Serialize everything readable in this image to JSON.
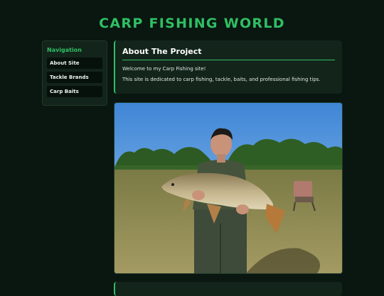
{
  "header": {
    "title": "CARP FISHING WORLD"
  },
  "sidebar": {
    "heading": "Navigation",
    "items": [
      {
        "label": "About Site"
      },
      {
        "label": "Tackle Brands"
      },
      {
        "label": "Carp Baits"
      }
    ]
  },
  "about": {
    "title": "About The Project",
    "paragraphs": [
      "Welcome to my Carp Fishing site!",
      "This site is dedicated to carp fishing, tackle, baits, and professional fishing tips."
    ]
  },
  "photo": {
    "subject": "person-holding-carp-photo"
  },
  "colors": {
    "accent": "#2fbf63",
    "background": "#0a1610",
    "card": "#13241b"
  }
}
